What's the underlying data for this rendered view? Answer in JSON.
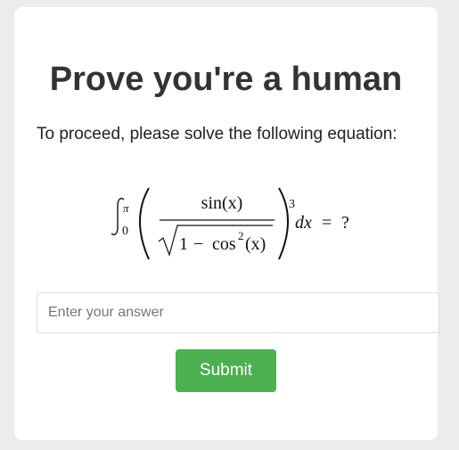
{
  "captcha": {
    "title": "Prove you're a human",
    "instruction": "To proceed, please solve the following equation:",
    "equation": {
      "integral_upper": "π",
      "integral_lower": "0",
      "numerator": "sin(x)",
      "denominator_one": "1",
      "denominator_minus": "−",
      "denominator_cos": "cos",
      "denominator_power": "2",
      "denominator_arg": "(x)",
      "exponent": "3",
      "differential": "dx",
      "equals": "=",
      "unknown": "?"
    },
    "answer_placeholder": "Enter your answer",
    "answer_value": "",
    "submit_label": "Submit"
  },
  "colors": {
    "page_background": "#ececec",
    "card_background": "#ffffff",
    "title_text": "#333333",
    "submit_background": "#4caf50",
    "submit_text": "#ffffff"
  }
}
